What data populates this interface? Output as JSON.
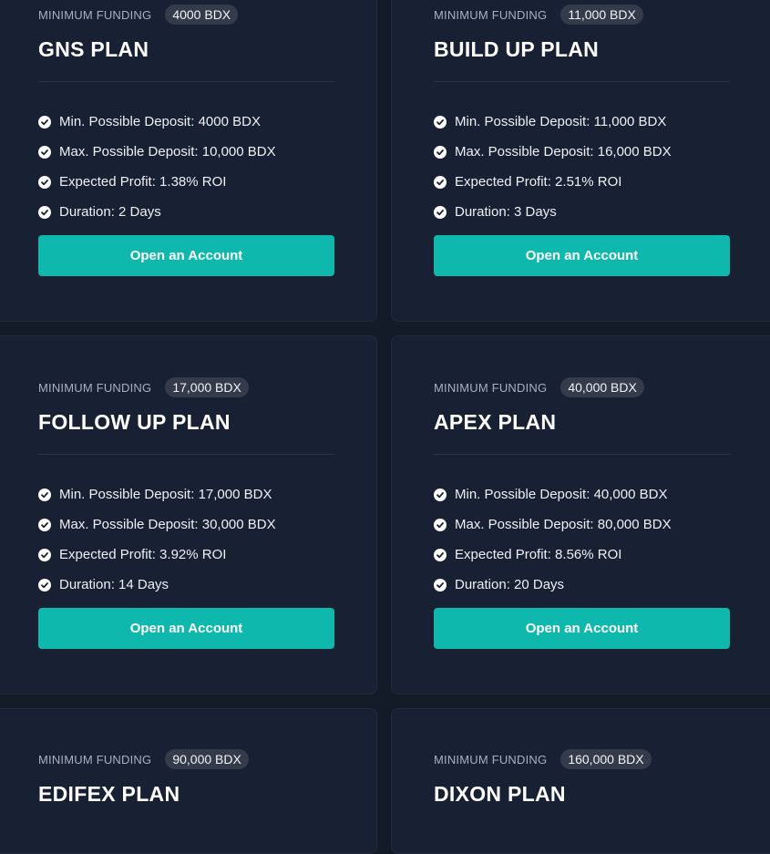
{
  "min_funding_label": "MINIMUM FUNDING",
  "button_label": "Open an Account",
  "colors": {
    "page_bg": "#131a28",
    "card_bg": "#182034",
    "accent": "#0fb8ad",
    "badge_bg": "#343c4b"
  },
  "plans": [
    {
      "name": "GNS PLAN",
      "badge": "4000 BDX",
      "features": [
        "Min. Possible Deposit: 4000 BDX",
        "Max. Possible Deposit: 10,000 BDX",
        "Expected Profit: 1.38% ROI",
        "Duration: 2 Days"
      ]
    },
    {
      "name": "BUILD UP PLAN",
      "badge": "11,000 BDX",
      "features": [
        "Min. Possible Deposit: 11,000 BDX",
        "Max. Possible Deposit: 16,000 BDX",
        "Expected Profit: 2.51% ROI",
        "Duration: 3 Days"
      ]
    },
    {
      "name": "FOLLOW UP PLAN",
      "badge": "17,000 BDX",
      "features": [
        "Min. Possible Deposit: 17,000 BDX",
        "Max. Possible Deposit: 30,000 BDX",
        "Expected Profit: 3.92% ROI",
        "Duration: 14 Days"
      ]
    },
    {
      "name": "APEX PLAN",
      "badge": "40,000 BDX",
      "features": [
        "Min. Possible Deposit: 40,000 BDX",
        "Max. Possible Deposit: 80,000 BDX",
        "Expected Profit: 8.56% ROI",
        "Duration: 20 Days"
      ]
    },
    {
      "name": "EDIFEX PLAN",
      "badge": "90,000 BDX"
    },
    {
      "name": "DIXON PLAN",
      "badge": "160,000 BDX"
    }
  ]
}
